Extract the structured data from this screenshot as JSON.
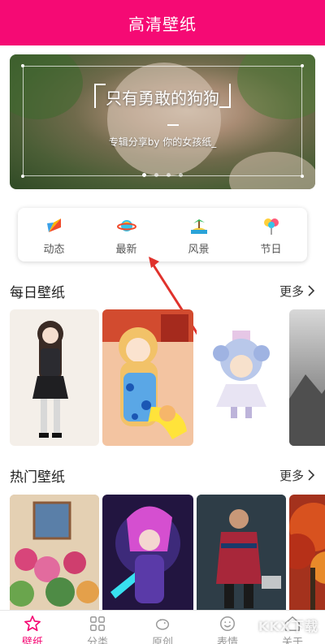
{
  "app": {
    "title": "高清壁纸"
  },
  "banner": {
    "headline": "只有勇敢的狗狗",
    "subline": "专辑分享by 你的女孩纸_",
    "dots": 4,
    "active_dot": 0
  },
  "categories": [
    {
      "label": "动态",
      "icon": "flag-icon"
    },
    {
      "label": "最新",
      "icon": "planet-icon"
    },
    {
      "label": "风景",
      "icon": "island-icon"
    },
    {
      "label": "节日",
      "icon": "balloon-icon"
    }
  ],
  "daily": {
    "title": "每日壁纸",
    "more": "更多"
  },
  "hot": {
    "title": "热门壁纸",
    "more": "更多"
  },
  "tabs": [
    {
      "label": "壁纸",
      "icon": "star-icon",
      "active": true
    },
    {
      "label": "分类",
      "icon": "grid-icon",
      "active": false
    },
    {
      "label": "原创",
      "icon": "piggy-icon",
      "active": false
    },
    {
      "label": "表情",
      "icon": "smile-icon",
      "active": false
    },
    {
      "label": "关于",
      "icon": "home-icon",
      "active": false
    }
  ],
  "watermark": "KKX下载",
  "colors": {
    "brand": "#f50a74"
  }
}
